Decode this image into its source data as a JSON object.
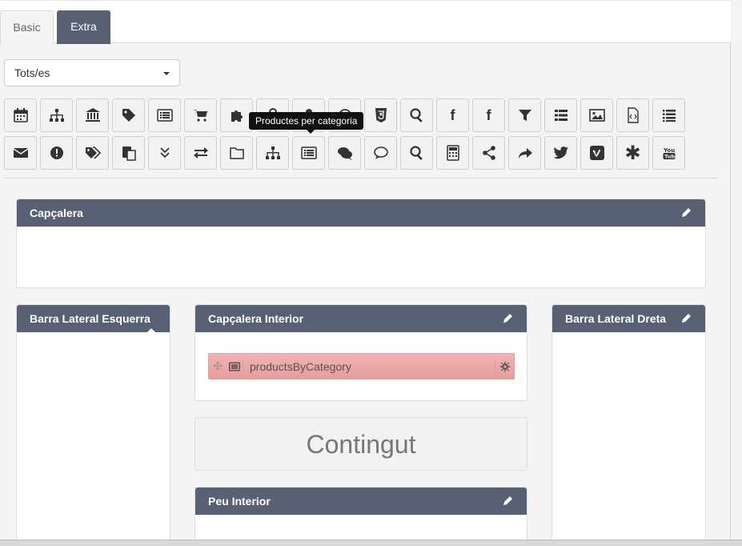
{
  "tabs": [
    {
      "label": "Basic",
      "active": false
    },
    {
      "label": "Extra",
      "active": true
    }
  ],
  "filter": {
    "selected": "Tots/es"
  },
  "tooltip": "Productes per categoria",
  "icons_row1": [
    "calendar-icon",
    "sitemap-icon",
    "bank-icon",
    "tag-icon",
    "list-alt-icon",
    "cart-icon",
    "puzzle-icon",
    "lock-icon",
    "user-icon",
    "at-icon",
    "html5-icon",
    "search-icon",
    "facebook-icon",
    "facebook-icon",
    "filter-icon",
    "list-icon",
    "image-icon",
    "code-file-icon",
    "list-ul-icon"
  ],
  "icons_row2": [
    "envelope-icon",
    "exclamation-icon",
    "tags-icon",
    "paste-icon",
    "double-down-icon",
    "exchange-icon",
    "folder-icon",
    "sitemap-icon",
    "list-alt-icon",
    "comments-icon",
    "comment-icon",
    "search-icon",
    "calculator-icon",
    "share-icon",
    "forward-icon",
    "twitter-icon",
    "vimeo-icon",
    "asterisk-icon",
    "youtube-icon"
  ],
  "panels": {
    "header": {
      "title": "Capçalera"
    },
    "left": {
      "title": "Barra Lateral Esquerra"
    },
    "inner_header": {
      "title": "Capçalera Interior",
      "module": "productsByCategory"
    },
    "right": {
      "title": "Barra Lateral Dreta"
    },
    "content": {
      "title": "Contingut"
    },
    "inner_footer": {
      "title": "Peu Interior"
    }
  },
  "colors": {
    "panel_header": "#586174",
    "module": "#eaa4a4"
  }
}
